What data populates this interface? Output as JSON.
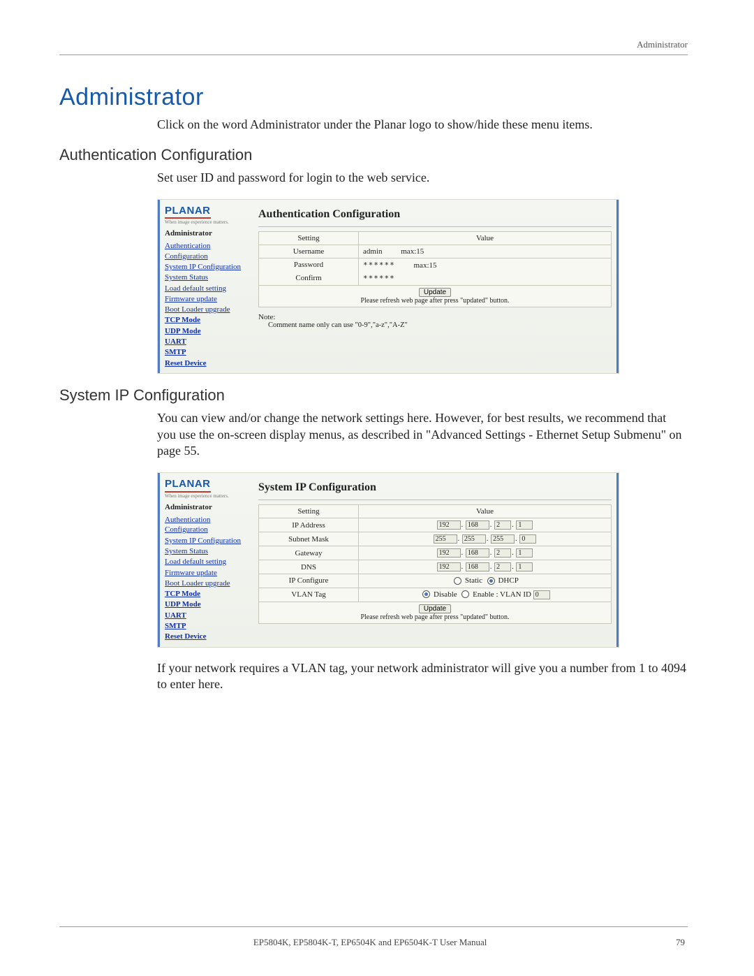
{
  "header": {
    "section": "Administrator"
  },
  "h1": "Administrator",
  "intro": "Click on the word Administrator under the Planar logo to show/hide these menu items.",
  "sections": {
    "auth": {
      "heading": "Authentication Configuration",
      "desc": "Set user ID and password for login to the web service."
    },
    "ip": {
      "heading": "System IP Configuration",
      "desc": "You can view and/or change the network settings here. However, for best results, we recommend that you use the on-screen display menus, as described in \"Advanced Settings - Ethernet Setup Submenu\" on page 55.",
      "post": "If your network requires a VLAN tag, your network administrator will give you a number from 1 to 4094 to enter here."
    }
  },
  "sidebar": {
    "logo": "PLANAR",
    "tagline": "When image experience matters.",
    "head": "Administrator",
    "links": [
      "Authentication Configuration",
      "System IP Configuration",
      "System Status",
      "Load default setting",
      "Firmware update",
      "Boot Loader upgrade",
      "TCP Mode",
      "UDP Mode",
      "UART",
      "SMTP",
      "Reset Device"
    ]
  },
  "authPane": {
    "title": "Authentication Configuration",
    "cols": {
      "setting": "Setting",
      "value": "Value"
    },
    "rows": {
      "username": {
        "label": "Username",
        "value": "admin",
        "max": "max:15"
      },
      "password": {
        "label": "Password",
        "value": "******",
        "max": "max:15"
      },
      "confirm": {
        "label": "Confirm",
        "value": "******"
      }
    },
    "update": "Update",
    "refresh": "Please refresh web page after press \"updated\" button.",
    "noteHead": "Note:",
    "noteLine": "Comment name only can use \"0-9\",\"a-z\",\"A-Z\""
  },
  "ipPane": {
    "title": "System IP Configuration",
    "cols": {
      "setting": "Setting",
      "value": "Value"
    },
    "rows": {
      "ip": {
        "label": "IP Address",
        "o": [
          "192",
          "168",
          "2",
          "1"
        ]
      },
      "mask": {
        "label": "Subnet Mask",
        "o": [
          "255",
          "255",
          "255",
          "0"
        ]
      },
      "gw": {
        "label": "Gateway",
        "o": [
          "192",
          "168",
          "2",
          "1"
        ]
      },
      "dns": {
        "label": "DNS",
        "o": [
          "192",
          "168",
          "2",
          "1"
        ]
      },
      "cfg": {
        "label": "IP Configure",
        "opt1": "Static",
        "opt2": "DHCP"
      },
      "vlan": {
        "label": "VLAN Tag",
        "opt1": "Disable",
        "opt2": "Enable",
        "idlabel": ": VLAN ID",
        "id": "0"
      }
    },
    "update": "Update",
    "refresh": "Please refresh web page after press \"updated\" button."
  },
  "footer": {
    "manual": "EP5804K, EP5804K-T, EP6504K and EP6504K-T User Manual",
    "page": "79"
  }
}
